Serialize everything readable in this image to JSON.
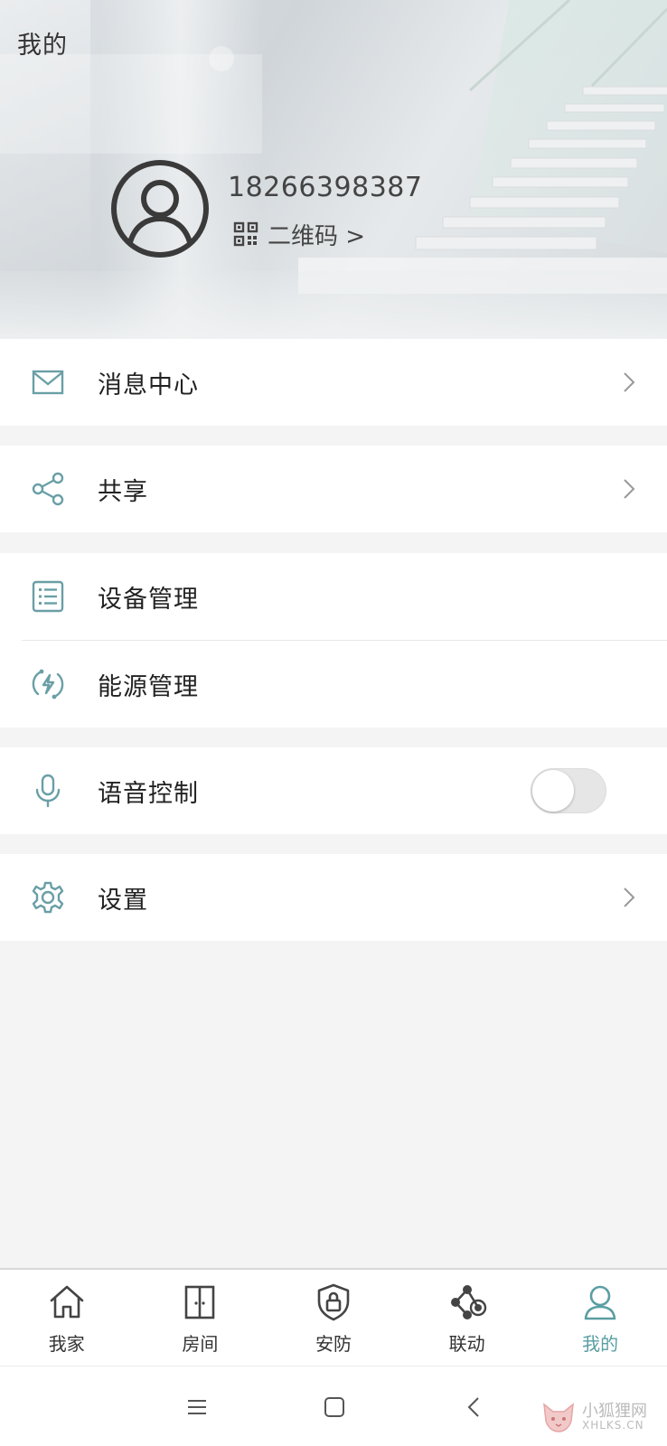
{
  "header": {
    "title": "我的",
    "phone": "18266398387",
    "qr_label": "二维码 >"
  },
  "menu": {
    "message_center": "消息中心",
    "share": "共享",
    "device_management": "设备管理",
    "energy_management": "能源管理",
    "voice_control": "语音控制",
    "voice_control_enabled": false,
    "settings": "设置"
  },
  "tabs": [
    {
      "label": "我家",
      "icon": "home-icon",
      "active": false
    },
    {
      "label": "房间",
      "icon": "room-icon",
      "active": false
    },
    {
      "label": "安防",
      "icon": "security-shield-icon",
      "active": false
    },
    {
      "label": "联动",
      "icon": "linkage-icon",
      "active": false
    },
    {
      "label": "我的",
      "icon": "profile-icon",
      "active": true
    }
  ],
  "watermark": {
    "cn": "小狐狸网",
    "en": "XHLKS.CN"
  },
  "colors": {
    "accent": "#5a9ea3",
    "icon_teal": "#6a9fa6"
  }
}
